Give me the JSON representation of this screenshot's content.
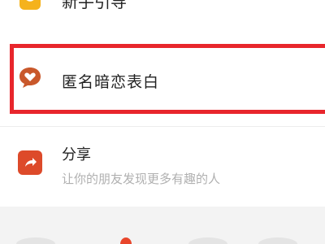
{
  "top_row": {
    "label": "新手引导",
    "icon": "yellow-app-icon"
  },
  "highlight_row": {
    "title": "匿名暗恋表白",
    "icon": "heart-chat-icon",
    "highlight_color": "#e8262c"
  },
  "share_row": {
    "title": "分享",
    "subtitle": "让你的朋友发现更多有趣的人",
    "icon": "share-arrow-icon",
    "icon_color": "#dd4a2a"
  },
  "bottom_nav": {
    "active_color": "#e8462b"
  }
}
